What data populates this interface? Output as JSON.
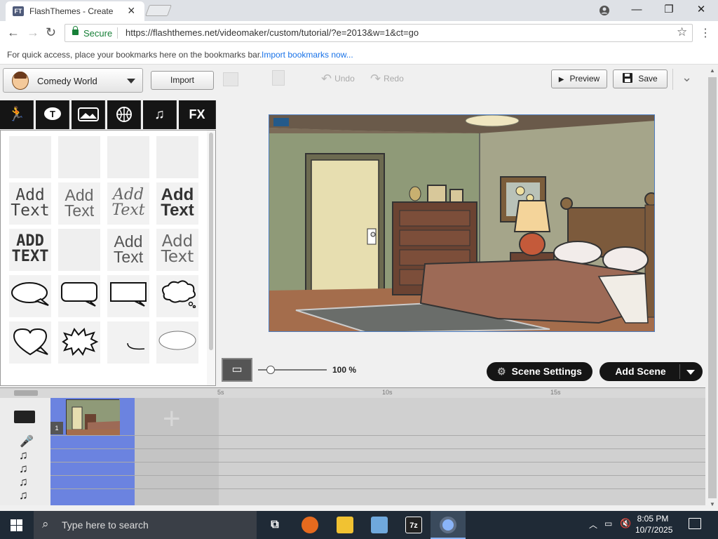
{
  "browser": {
    "tab_title": "FlashThemes - Create",
    "tab_favicon": "FT",
    "url": "https://flashthemes.net/videomaker/custom/tutorial/?e=2013&w=1&ct=go",
    "secure_label": "Secure",
    "bookmarks_hint": "For quick access, place your bookmarks here on the bookmarks bar.",
    "import_bookmarks": "Import bookmarks now..."
  },
  "app": {
    "theme_selector": "Comedy World",
    "import_button": "Import",
    "category_tabs": [
      "character",
      "text",
      "prop",
      "sports",
      "music",
      "FX"
    ],
    "undo": "Undo",
    "redo": "Redo",
    "preview": "Preview",
    "save": "Save",
    "zoom": "100 %",
    "scene_settings": "Scene Settings",
    "add_scene": "Add Scene",
    "library_text": [
      [
        "Add",
        "Text"
      ],
      [
        "Add",
        "Text"
      ],
      [
        "Add",
        "Text"
      ],
      [
        "Add",
        "Text"
      ],
      [
        "ADD",
        "TEXT"
      ],
      [
        "Add",
        "Text"
      ],
      [
        "Add",
        "Text"
      ]
    ],
    "ruler": [
      "5s",
      "10s",
      "15s"
    ],
    "scene_number": "1"
  },
  "taskbar": {
    "search_placeholder": "Type here to search",
    "time": "8:05 PM",
    "date": "10/7/2025"
  },
  "colors": {
    "accent": "#1a73e8",
    "secure_green": "#188038",
    "timeline_selection": "#6b83e0",
    "dark_pill": "#151515"
  }
}
